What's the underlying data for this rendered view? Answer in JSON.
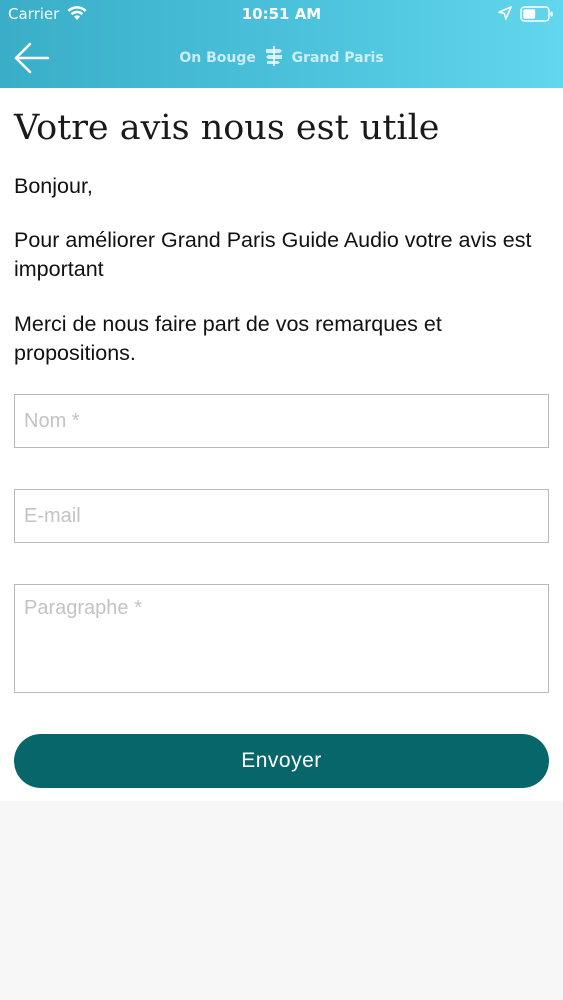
{
  "status_bar": {
    "carrier": "Carrier",
    "time": "10:51 AM"
  },
  "nav": {
    "back_icon": "arrow-left-icon",
    "brand_left": "On Bouge",
    "brand_right": "Grand Paris",
    "brand_icon": "signpost-logo-icon"
  },
  "page": {
    "title": "Votre avis nous est utile",
    "greeting": "Bonjour,",
    "intro": "Pour améliorer Grand Paris Guide Audio votre avis est important",
    "request": "Merci de nous faire part de vos remarques et propositions."
  },
  "form": {
    "name_placeholder": "Nom *",
    "email_placeholder": "E-mail",
    "message_placeholder": "Paragraphe *",
    "submit_label": "Envoyer"
  },
  "colors": {
    "header_gradient_start": "#3aaec7",
    "header_gradient_end": "#62d6ec",
    "button": "#07666a",
    "background": "#f7f7f8"
  }
}
